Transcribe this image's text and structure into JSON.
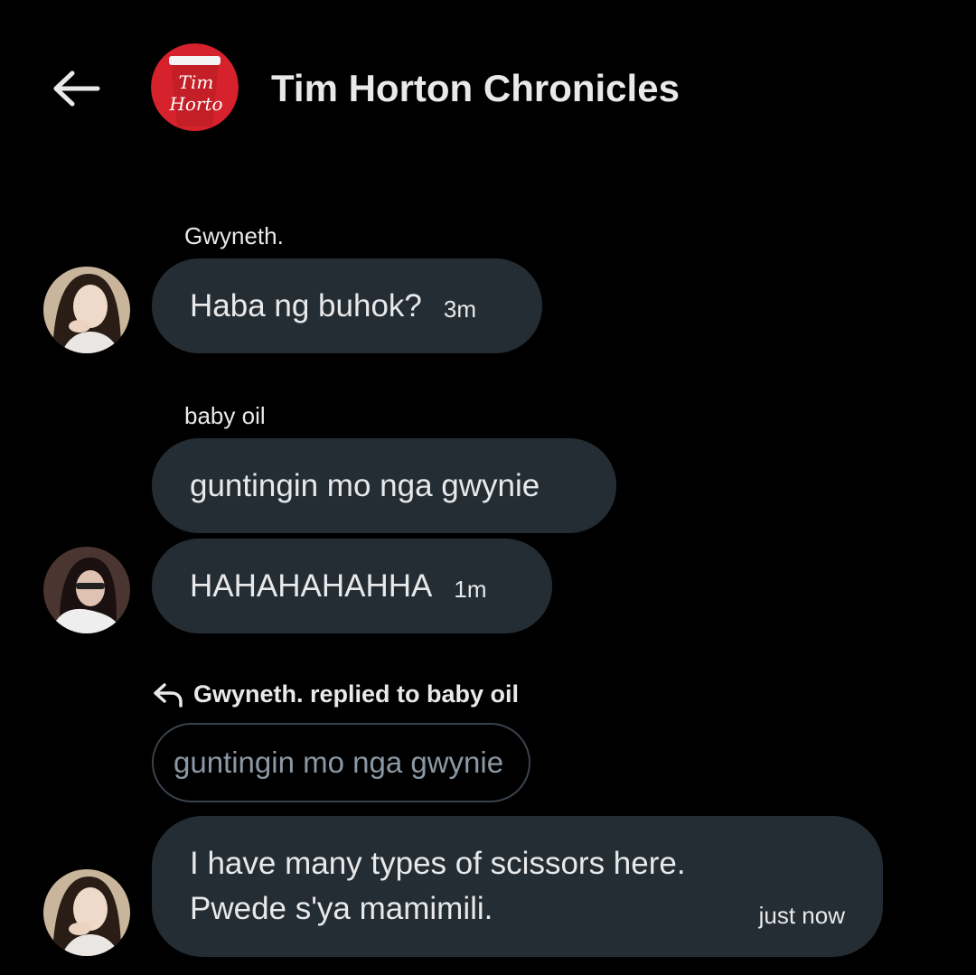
{
  "header": {
    "title": "Tim Horton Chronicles",
    "logo_text_1": "Tim",
    "logo_text_2": "Horto",
    "logo_color": "#d6222c"
  },
  "messages": [
    {
      "sender": "Gwyneth.",
      "text": "Haba ng buhok?",
      "time": "3m"
    },
    {
      "sender": "baby oil",
      "text": "guntingin mo nga gwynie"
    },
    {
      "text": "HAHAHAHAHHA",
      "time": "1m"
    }
  ],
  "reply": {
    "label": "Gwyneth. replied to baby oil",
    "quoted": "guntingin mo nga gwynie",
    "line1": "I have many types of scissors here.",
    "line2": "Pwede s'ya mamimili.",
    "time": "just now"
  },
  "colors": {
    "background": "#000000",
    "bubble": "#252d34",
    "text": "#e7e9ea",
    "muted": "#8b98a5"
  }
}
